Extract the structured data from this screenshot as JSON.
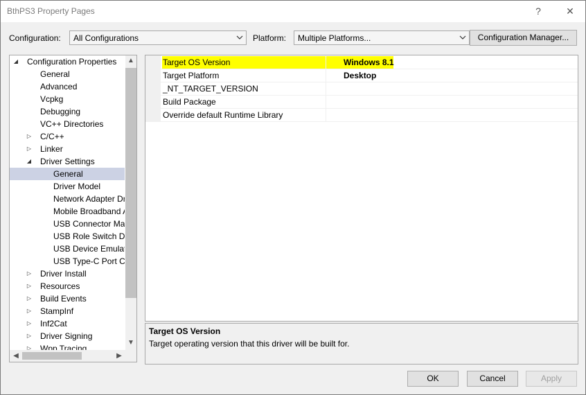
{
  "window": {
    "title": "BthPS3 Property Pages"
  },
  "titlebar": {
    "help": "?",
    "close": "✕"
  },
  "config": {
    "label": "Configuration:",
    "value": "All Configurations"
  },
  "platform": {
    "label": "Platform:",
    "value": "Multiple Platforms..."
  },
  "buttons": {
    "config_manager": "Configuration Manager...",
    "ok": "OK",
    "cancel": "Cancel",
    "apply": "Apply"
  },
  "tree": {
    "items": [
      {
        "label": "Configuration Properties",
        "level": 0,
        "expander": "expanded"
      },
      {
        "label": "General",
        "level": 1,
        "expander": "none"
      },
      {
        "label": "Advanced",
        "level": 1,
        "expander": "none"
      },
      {
        "label": "Vcpkg",
        "level": 1,
        "expander": "none"
      },
      {
        "label": "Debugging",
        "level": 1,
        "expander": "none"
      },
      {
        "label": "VC++ Directories",
        "level": 1,
        "expander": "none"
      },
      {
        "label": "C/C++",
        "level": 1,
        "expander": "collapsed"
      },
      {
        "label": "Linker",
        "level": 1,
        "expander": "collapsed"
      },
      {
        "label": "Driver Settings",
        "level": 1,
        "expander": "expanded"
      },
      {
        "label": "General",
        "level": 2,
        "expander": "none",
        "selected": true
      },
      {
        "label": "Driver Model",
        "level": 2,
        "expander": "none"
      },
      {
        "label": "Network Adapter Dr",
        "level": 2,
        "expander": "none"
      },
      {
        "label": "Mobile Broadband A",
        "level": 2,
        "expander": "none"
      },
      {
        "label": "USB Connector Man",
        "level": 2,
        "expander": "none"
      },
      {
        "label": "USB Role Switch Dri",
        "level": 2,
        "expander": "none"
      },
      {
        "label": "USB Device Emulati",
        "level": 2,
        "expander": "none"
      },
      {
        "label": "USB Type-C Port Co",
        "level": 2,
        "expander": "none"
      },
      {
        "label": "Driver Install",
        "level": 1,
        "expander": "collapsed"
      },
      {
        "label": "Resources",
        "level": 1,
        "expander": "collapsed"
      },
      {
        "label": "Build Events",
        "level": 1,
        "expander": "collapsed"
      },
      {
        "label": "StampInf",
        "level": 1,
        "expander": "collapsed"
      },
      {
        "label": "Inf2Cat",
        "level": 1,
        "expander": "collapsed"
      },
      {
        "label": "Driver Signing",
        "level": 1,
        "expander": "collapsed"
      },
      {
        "label": "Wpp Tracing",
        "level": 1,
        "expander": "collapsed"
      }
    ]
  },
  "properties": [
    {
      "name": "Target OS Version",
      "value": "Windows 8.1",
      "highlighted": true
    },
    {
      "name": "Target Platform",
      "value": "Desktop"
    },
    {
      "name": "_NT_TARGET_VERSION",
      "value": ""
    },
    {
      "name": "Build Package",
      "value": ""
    },
    {
      "name": "Override default Runtime Library",
      "value": ""
    }
  ],
  "description": {
    "title": "Target OS Version",
    "text": "Target operating version that this driver will be built for."
  },
  "colors": {
    "highlight": "#ffff00",
    "selected": "#ccd2e4"
  }
}
